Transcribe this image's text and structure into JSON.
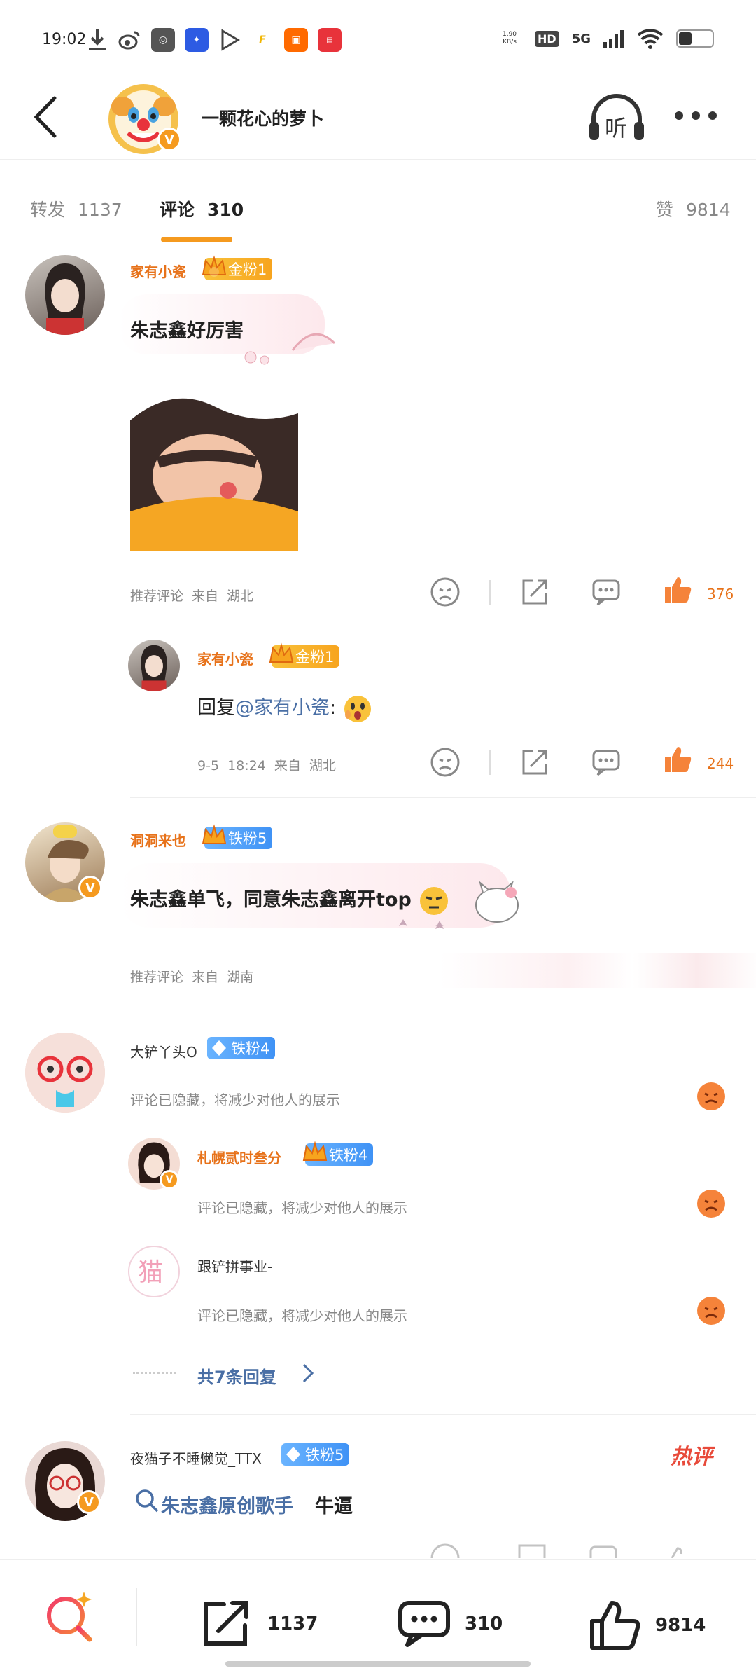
{
  "status_bar": {
    "time": "19:02",
    "network_speed": "1.90 KB/s",
    "hd": "HD",
    "signal": "5G"
  },
  "header": {
    "author_name": "一颗花心的萝卜",
    "listen_label": "听"
  },
  "tabs": [
    {
      "label": "转发",
      "count": "1137"
    },
    {
      "label": "评论",
      "count": "310"
    },
    {
      "label": "赞",
      "count": "9814"
    }
  ],
  "comments": [
    {
      "username": "家有小瓷",
      "badge": "金粉1",
      "badge_level": "3",
      "text": "朱志鑫好厉害",
      "meta": "推荐评论  来自  湖北",
      "likes": "376",
      "reply": {
        "username": "家有小瓷",
        "badge": "金粉1",
        "prefix": "回复",
        "mention": "@家有小瓷",
        "colon": ":",
        "meta": "9-5  18:24  来自  湖北",
        "likes": "244"
      }
    },
    {
      "username": "洞洞来也",
      "badge": "铁粉5",
      "badge_level": "4",
      "text": "朱志鑫单飞，同意朱志鑫离开top",
      "meta": "推荐评论  来自  湖南"
    },
    {
      "username": "大铲丫头O",
      "badge": "铁粉4",
      "hidden": "评论已隐藏，将减少对他人的展示",
      "replies": [
        {
          "username": "札幌贰时叁分",
          "badge": "铁粉4",
          "hidden": "评论已隐藏，将减少对他人的展示"
        },
        {
          "username": "跟铲拼事业-",
          "hidden": "评论已隐藏，将减少对他人的展示"
        }
      ],
      "more_replies": "共7条回复"
    },
    {
      "username": "夜猫子不睡懒觉_TTX",
      "badge": "铁粉5",
      "hot_label": "热评",
      "search_link": "朱志鑫原创歌手",
      "text": "牛逼"
    }
  ],
  "bottom_bar": {
    "repost_count": "1137",
    "comment_count": "310",
    "like_count": "9814"
  },
  "colors": {
    "accent": "#f59a1f",
    "orange_text": "#e7721a",
    "link_blue": "#4a6fa5",
    "fan_blue": "#3f92f5"
  }
}
